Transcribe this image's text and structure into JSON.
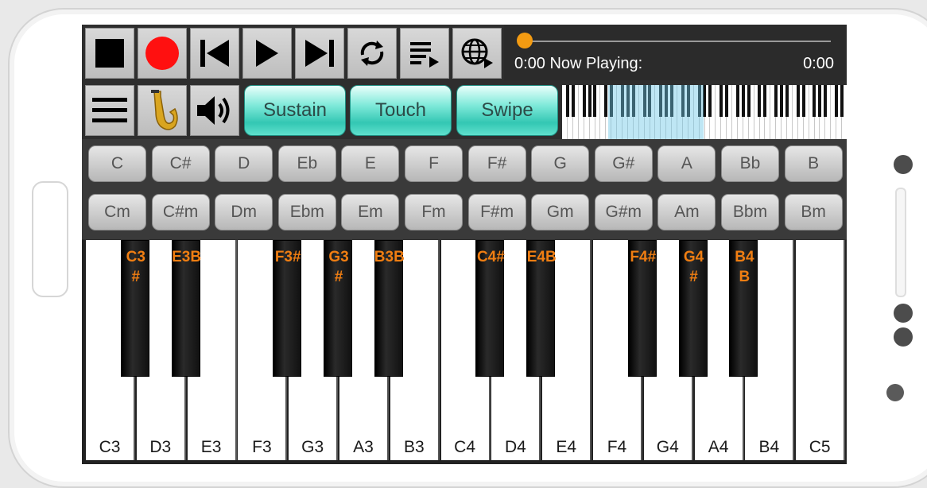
{
  "player": {
    "time_elapsed_label": "0:00 Now Playing:",
    "time_total": "0:00"
  },
  "modes": {
    "sustain": "Sustain",
    "touch": "Touch",
    "swipe": "Swipe"
  },
  "chords": {
    "major": [
      "C",
      "C#",
      "D",
      "Eb",
      "E",
      "F",
      "F#",
      "G",
      "G#",
      "A",
      "Bb",
      "B"
    ],
    "minor": [
      "Cm",
      "C#m",
      "Dm",
      "Ebm",
      "Em",
      "Fm",
      "F#m",
      "Gm",
      "G#m",
      "Am",
      "Bbm",
      "Bm"
    ]
  },
  "keyboard": {
    "white_keys": [
      "C3",
      "D3",
      "E3",
      "F3",
      "G3",
      "A3",
      "B3",
      "C4",
      "D4",
      "E4",
      "F4",
      "G4",
      "A4",
      "B4",
      "C5"
    ],
    "black_keys": [
      "C3\n#",
      "E3B",
      "F3#",
      "G3\n#",
      "B3B",
      "C4#",
      "E4B",
      "F4#",
      "G4\n#",
      "B4\nB"
    ]
  },
  "colors": {
    "accent_orange": "#f07e12",
    "teal_button": "#33c7b3",
    "record_red": "#ff1010"
  },
  "icons": [
    "stop-icon",
    "record-icon",
    "skip-back-icon",
    "play-icon",
    "skip-forward-icon",
    "repeat-icon",
    "playlist-icon",
    "globe-icon",
    "menu-icon",
    "saxophone-icon",
    "volume-icon"
  ]
}
